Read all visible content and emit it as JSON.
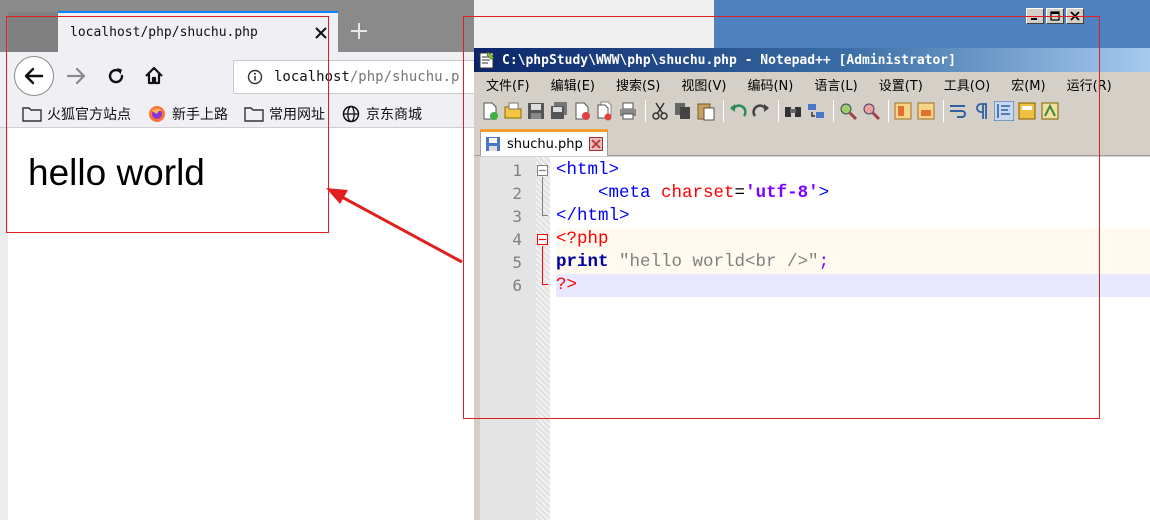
{
  "browser": {
    "tab_title": "localhost/php/shuchu.php",
    "url_host": "localhost",
    "url_path": "/php/shuchu.p",
    "bookmarks": [
      {
        "label": "火狐官方站点",
        "icon": "folder-icon"
      },
      {
        "label": "新手上路",
        "icon": "firefox-icon"
      },
      {
        "label": "常用网址",
        "icon": "folder-icon"
      },
      {
        "label": "京东商城",
        "icon": "globe-icon"
      }
    ],
    "page_text": "hello world"
  },
  "editor": {
    "title": "C:\\phpStudy\\WWW\\php\\shuchu.php - Notepad++ [Administrator]",
    "menu": [
      "文件(F)",
      "编辑(E)",
      "搜索(S)",
      "视图(V)",
      "编码(N)",
      "语言(L)",
      "设置(T)",
      "工具(O)",
      "宏(M)",
      "运行(R)"
    ],
    "tab_name": "shuchu.php",
    "line_numbers": [
      "1",
      "2",
      "3",
      "4",
      "5",
      "6"
    ],
    "code": {
      "l1_tag": "<html>",
      "l2_indent": "    ",
      "l2_open": "<meta ",
      "l2_attr": "charset",
      "l2_eq": "=",
      "l2_val": "'utf-8'",
      "l2_close": ">",
      "l3_tag": "</html>",
      "l4_php": "<?php",
      "l5_kw": "print",
      "l5_str": " \"hello world<br />\"",
      "l5_semi": ";",
      "l6_php": "?>"
    },
    "system_buttons": [
      "minimize-icon",
      "maximize-icon",
      "close-icon"
    ]
  },
  "colors": {
    "annotation": "#e02020",
    "titlebar": "#0a246a",
    "firefox_accent": "#0a84ff"
  }
}
